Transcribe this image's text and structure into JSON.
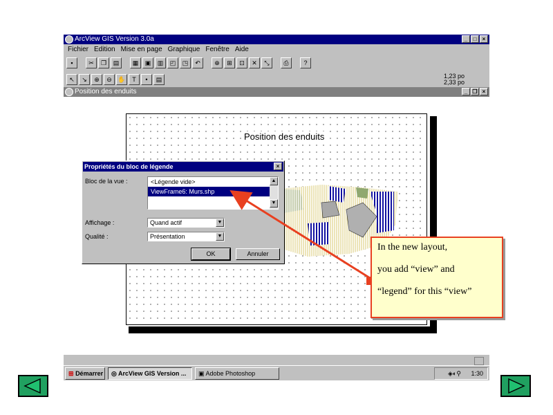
{
  "window": {
    "title": "ArcView GIS Version 3.0a",
    "menu": [
      "Fichier",
      "Edition",
      "Mise en page",
      "Graphique",
      "Fenêtre",
      "Aide"
    ],
    "coords": {
      "x": "1,23 po",
      "y": "2,33 po"
    }
  },
  "document": {
    "title": "Position des enduits",
    "layout_title": "Position des enduits"
  },
  "dialog": {
    "title": "Propriétés du bloc de légende",
    "view_label": "Bloc de la vue :",
    "list_items": [
      "<Légende vide>",
      "ViewFrame6: Murs.shp"
    ],
    "selected_index": 1,
    "display_label": "Affichage :",
    "display_value": "Quand actif",
    "quality_label": "Qualité :",
    "quality_value": "Présentation",
    "ok_label": "OK",
    "cancel_label": "Annuler"
  },
  "taskbar": {
    "start_label": "Démarrer",
    "items": [
      "ArcView GIS Version ...",
      "Adobe Photoshop"
    ],
    "active_index": 0,
    "clock": "1:30"
  },
  "callout": {
    "lines": [
      "In the new layout,",
      "you add “view” and",
      " “legend”  for this “view”"
    ],
    "border_color": "#e84020",
    "background": "#ffffcc"
  },
  "nav": {
    "prev": "previous-slide",
    "next": "next-slide"
  }
}
